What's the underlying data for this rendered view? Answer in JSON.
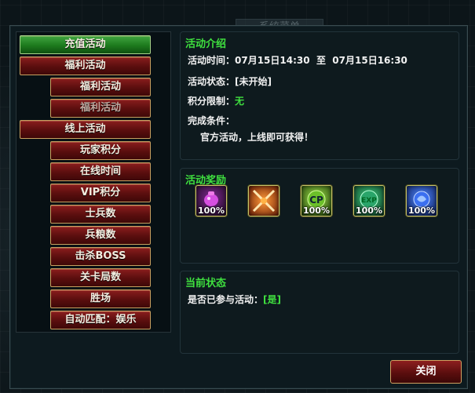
{
  "window": {
    "background_title": "系统菜单"
  },
  "menu": {
    "recharge": "充值活动",
    "welfare": "福利活动",
    "welfare_sub_1": "福利活动",
    "welfare_sub_2": "福利活动",
    "online": "线上活动",
    "online_items": [
      "玩家积分",
      "在线时间",
      "VIP积分",
      "士兵数",
      "兵粮数",
      "击杀BOSS",
      "关卡局数",
      "胜场",
      "自动匹配：娱乐"
    ]
  },
  "intro": {
    "title": "活动介绍",
    "time_label": "活动时间：",
    "time_value": "07月15日14:30  至  07月15日16:30",
    "status_label": "活动状态：",
    "status_value": "[未开始]",
    "points_label": "积分限制：",
    "points_value": "无",
    "condition_label": "完成条件：",
    "condition_value": "官方活动，上线即可获得！"
  },
  "rewards": {
    "title": "活动奖励",
    "items": [
      {
        "icon": "pink-pouch-icon",
        "percent": "100%",
        "color": "#c03ad0"
      },
      {
        "icon": "crossed-swords-icon",
        "percent": "",
        "color": "#ff7a1e"
      },
      {
        "icon": "cp-potion-icon",
        "label": "CP",
        "percent": "100%",
        "color": "#7bd23b"
      },
      {
        "icon": "exp-potion-icon",
        "label": "EXP",
        "percent": "100%",
        "color": "#2aa56a"
      },
      {
        "icon": "blue-orb-icon",
        "percent": "100%",
        "color": "#3b6ff0"
      }
    ]
  },
  "current": {
    "title": "当前状态",
    "participate_label": "是否已参与活动：",
    "participate_value": "[是]"
  },
  "close_label": "关闭",
  "colors": {
    "accent_green": "#3fe03f",
    "button_red": "#6a1212",
    "button_green": "#1d7a1d",
    "border_gold": "#c8a060"
  }
}
